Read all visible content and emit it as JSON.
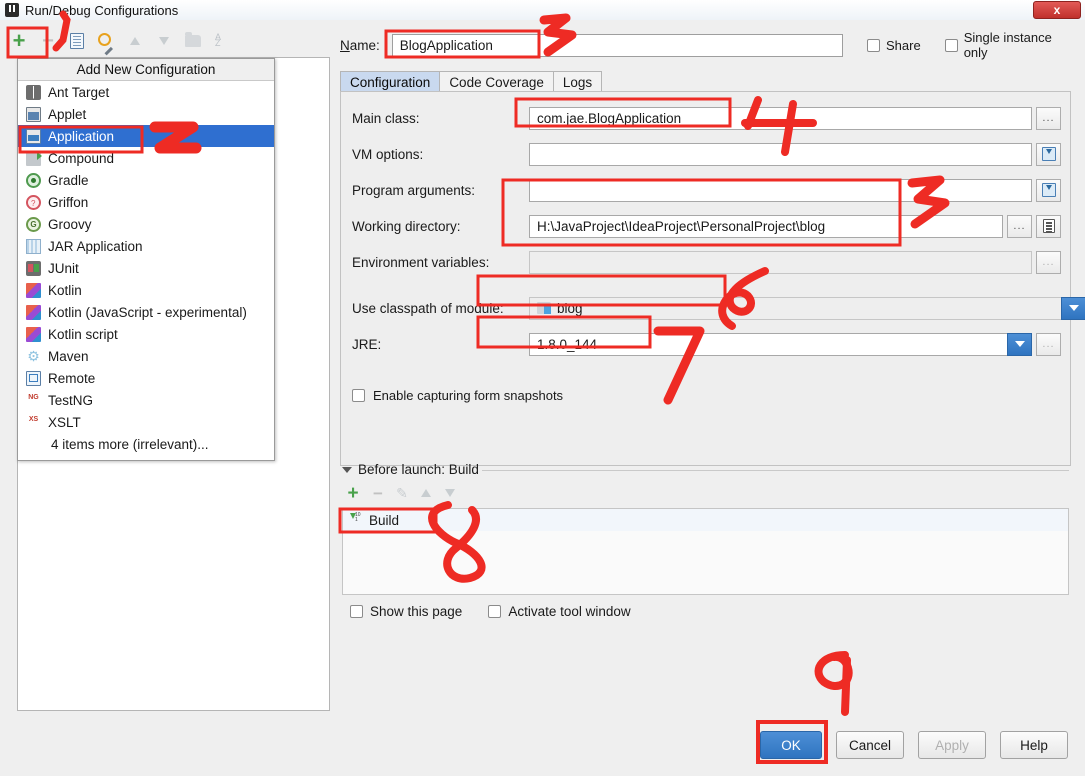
{
  "window": {
    "title": "Run/Debug Configurations",
    "close_label": "x",
    "app_icon": "intellij-idea-icon"
  },
  "toolbar": {
    "add_label": "+",
    "remove_label": "−",
    "copy_label": "copy-configuration",
    "edit_label": "edit-templates",
    "moveup_label": "move-up",
    "movedown_label": "move-down",
    "folder_label": "create-folder",
    "sort_label": "sort-configurations"
  },
  "popup": {
    "header": "Add New Configuration",
    "items": [
      {
        "label": "Ant Target",
        "icon": "ant-icon",
        "selected": false
      },
      {
        "label": "Applet",
        "icon": "applet-icon",
        "selected": false
      },
      {
        "label": "Application",
        "icon": "application-icon",
        "selected": true
      },
      {
        "label": "Compound",
        "icon": "compound-icon",
        "selected": false
      },
      {
        "label": "Gradle",
        "icon": "gradle-icon",
        "selected": false
      },
      {
        "label": "Griffon",
        "icon": "griffon-icon",
        "selected": false
      },
      {
        "label": "Groovy",
        "icon": "groovy-icon",
        "selected": false
      },
      {
        "label": "JAR Application",
        "icon": "jar-icon",
        "selected": false
      },
      {
        "label": "JUnit",
        "icon": "junit-icon",
        "selected": false
      },
      {
        "label": "Kotlin",
        "icon": "kotlin-icon",
        "selected": false
      },
      {
        "label": "Kotlin (JavaScript - experimental)",
        "icon": "kotlin-icon",
        "selected": false
      },
      {
        "label": "Kotlin script",
        "icon": "kotlin-icon",
        "selected": false
      },
      {
        "label": "Maven",
        "icon": "maven-icon",
        "selected": false
      },
      {
        "label": "Remote",
        "icon": "remote-icon",
        "selected": false
      },
      {
        "label": "TestNG",
        "icon": "testng-icon",
        "selected": false
      },
      {
        "label": "XSLT",
        "icon": "xslt-icon",
        "selected": false
      },
      {
        "label": "4 items more (irrelevant)...",
        "icon": "none",
        "selected": false
      }
    ]
  },
  "form": {
    "name_label": "Name:",
    "name_value": "BlogApplication",
    "share_label": "Share",
    "share_checked": false,
    "single_instance_label": "Single instance only",
    "single_instance_checked": false,
    "tabs": [
      {
        "label": "Configuration",
        "active": true
      },
      {
        "label": "Code Coverage",
        "active": false
      },
      {
        "label": "Logs",
        "active": false
      }
    ],
    "fields": {
      "main_class_label": "Main class:",
      "main_class_value": "com.jae.BlogApplication",
      "vm_options_label": "VM options:",
      "vm_options_value": "",
      "program_arguments_label": "Program arguments:",
      "program_arguments_value": "",
      "working_directory_label": "Working directory:",
      "working_directory_value": "H:\\JavaProject\\IdeaProject\\PersonalProject\\blog",
      "environment_variables_label": "Environment variables:",
      "environment_variables_value": "",
      "classpath_label": "Use classpath of module:",
      "classpath_value": "blog",
      "jre_label": "JRE:",
      "jre_value": "1.8.0_144",
      "snapshots_label": "Enable capturing form snapshots",
      "snapshots_checked": false,
      "browse_label": "...",
      "macro_label": "insert-macro-icon",
      "list_label": "list-icon"
    },
    "before_launch": {
      "title": "Before launch: Build",
      "add_label": "+",
      "remove_label": "−",
      "edit_label": "edit-icon",
      "moveup_label": "move-up-icon",
      "movedown_label": "move-down-icon",
      "items": [
        {
          "label": "Build",
          "icon": "build-icon"
        }
      ],
      "show_page_label": "Show this page",
      "show_page_checked": false,
      "activate_window_label": "Activate tool window",
      "activate_window_checked": false
    }
  },
  "buttons": [
    {
      "label": "OK",
      "style": "primary",
      "enabled": true
    },
    {
      "label": "Cancel",
      "style": "normal",
      "enabled": true
    },
    {
      "label": "Apply",
      "style": "normal",
      "enabled": false
    },
    {
      "label": "Help",
      "style": "normal",
      "enabled": true
    }
  ],
  "annotations": {
    "color": "#ee2b24",
    "marks": [
      {
        "num": "1",
        "target": "add-configuration-button"
      },
      {
        "num": "2",
        "target": "popup-item-application"
      },
      {
        "num": "3",
        "target": "name-input"
      },
      {
        "num": "4",
        "target": "main-class-input"
      },
      {
        "num": "5",
        "target": "working-directory-input"
      },
      {
        "num": "6",
        "target": "classpath-module-combo"
      },
      {
        "num": "7",
        "target": "jre-input"
      },
      {
        "num": "8",
        "target": "before-launch-build-item"
      },
      {
        "num": "9",
        "target": "ok-button"
      }
    ]
  }
}
